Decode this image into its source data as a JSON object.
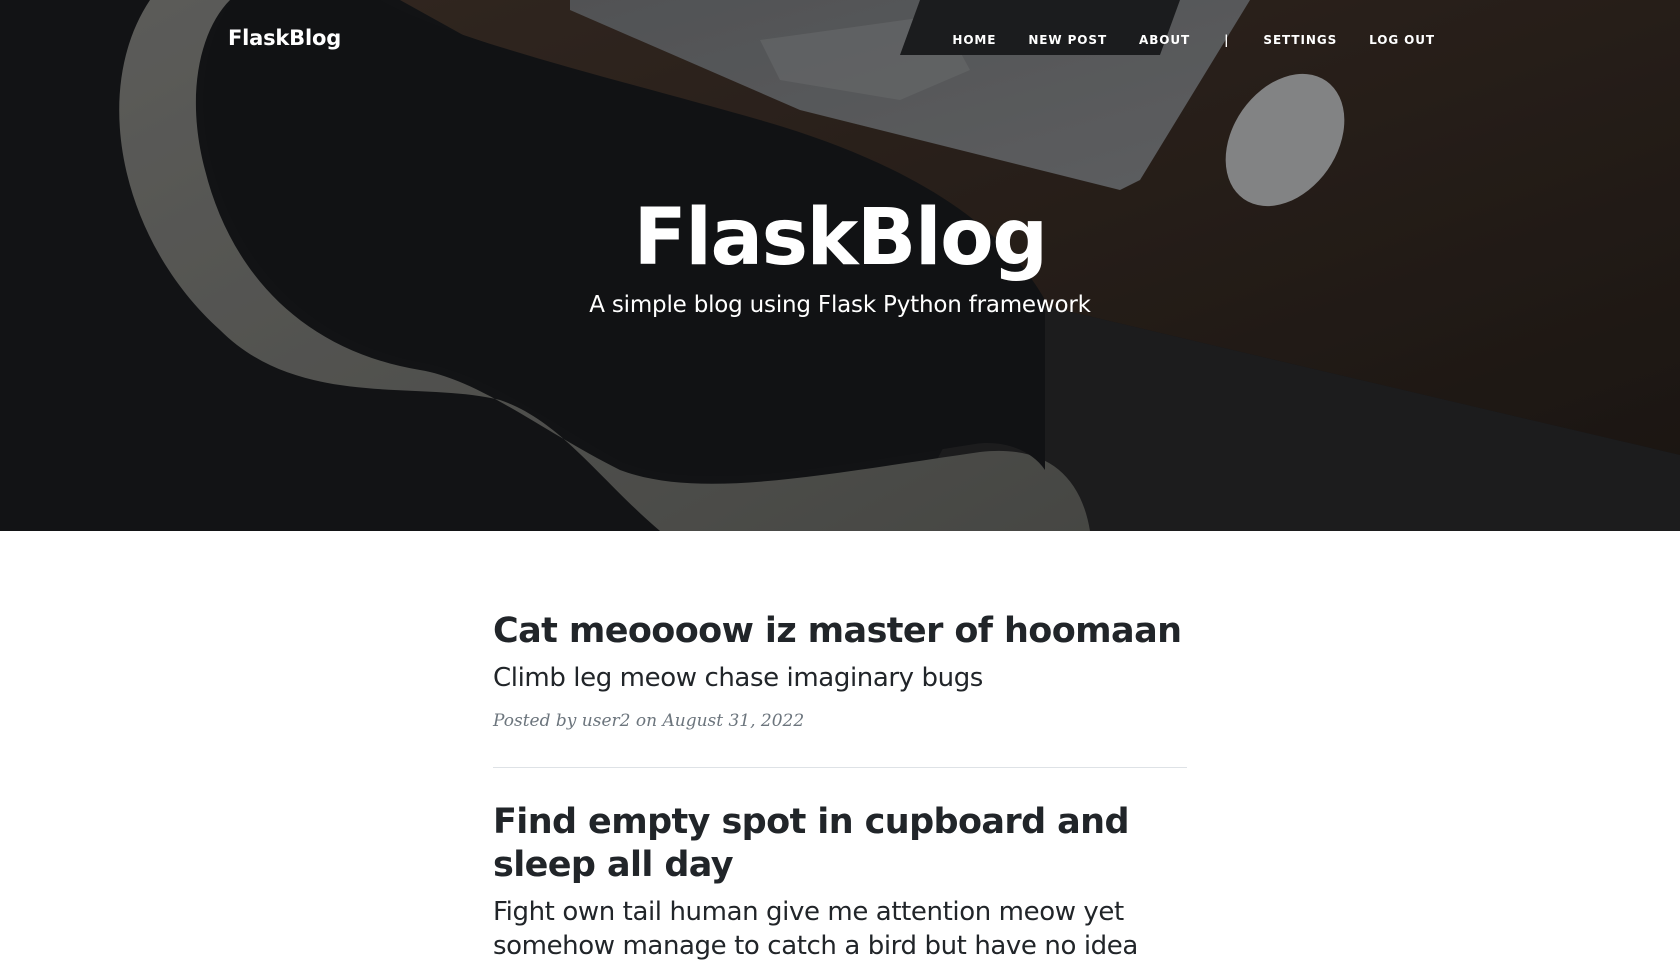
{
  "navbar": {
    "brand": "FlaskBlog",
    "links": [
      "HOME",
      "NEW POST",
      "ABOUT",
      "|",
      "SETTINGS",
      "LOG OUT"
    ]
  },
  "hero": {
    "title": "FlaskBlog",
    "subtitle": "A simple blog using Flask Python framework"
  },
  "posts": [
    {
      "title": "Cat meoooow iz master of hoomaan",
      "subtitle": "Climb leg meow chase imaginary bugs",
      "meta_prefix": "Posted by",
      "author": "user2",
      "meta_on": "on",
      "date": "August 31, 2022"
    },
    {
      "title": "Find empty spot in cupboard and sleep all day",
      "subtitle": "Fight own tail human give me attention meow yet somehow manage to catch a bird but have no idea"
    }
  ],
  "colors": {
    "text": "#212529",
    "meta": "#6c757d",
    "divider": "#dee2e6"
  }
}
